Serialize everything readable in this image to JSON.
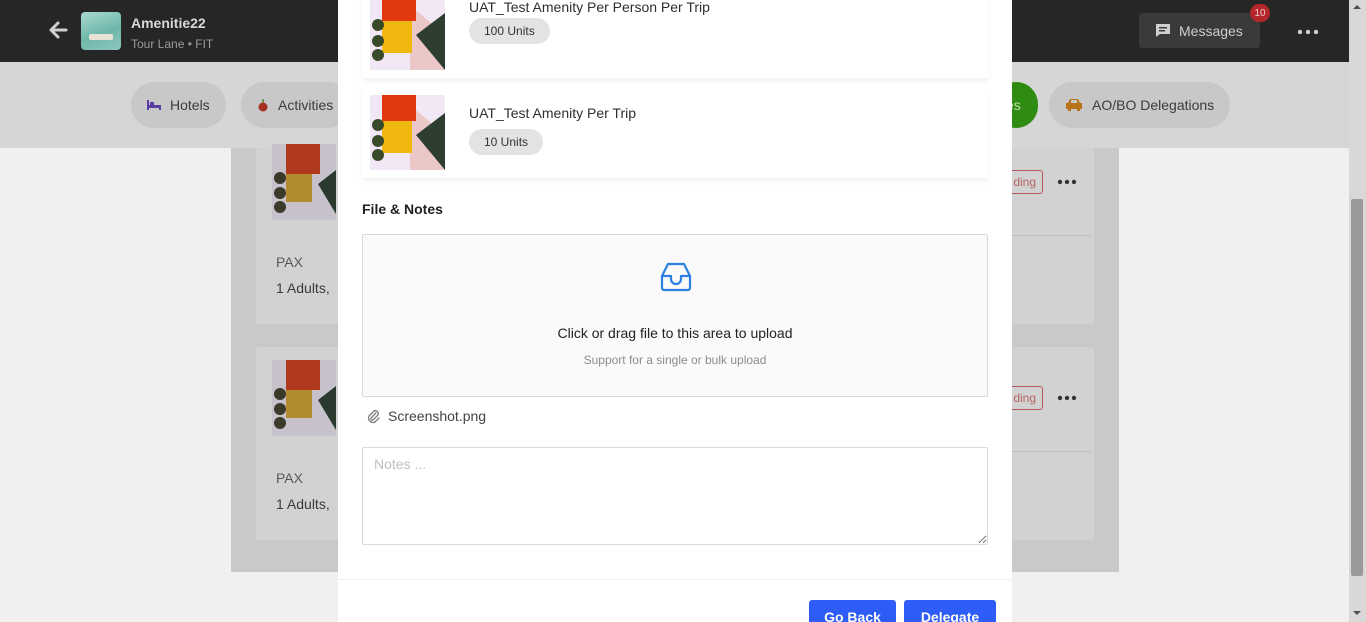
{
  "header": {
    "trip_title": "Amenitie22",
    "trip_subtitle": "Tour Lane • FIT",
    "messages_label": "Messages",
    "messages_count": "10"
  },
  "tabs": [
    {
      "label": "Hotels",
      "icon": "bed-icon"
    },
    {
      "label": "Activities",
      "icon": "apple-icon"
    },
    {
      "label": "es",
      "icon": "none"
    },
    {
      "label": "AO/BO Delegations",
      "icon": "car-icon"
    }
  ],
  "background_items": [
    {
      "pax_label": "PAX",
      "pax_value": "1 Adults,",
      "status": "ding"
    },
    {
      "pax_label": "PAX",
      "pax_value": "1 Adults,",
      "status": "ding"
    }
  ],
  "modal": {
    "amenities": [
      {
        "title": "UAT_Test Amenity Per Person Per Trip",
        "units": "100 Units"
      },
      {
        "title": "UAT_Test Amenity Per Trip",
        "units": "10 Units"
      }
    ],
    "section_title": "File & Notes",
    "upload": {
      "text": "Click or drag file to this area to upload",
      "hint": "Support for a single or bulk upload"
    },
    "attached_file": "Screenshot.png",
    "notes_placeholder": "Notes ...",
    "buttons": {
      "go_back": "Go Back",
      "delegate": "Delegate"
    }
  },
  "colors": {
    "primary_button": "#2d5cf6",
    "topbar": "#262626",
    "badge": "#b3262a",
    "active_tab": "#2f8c12"
  }
}
